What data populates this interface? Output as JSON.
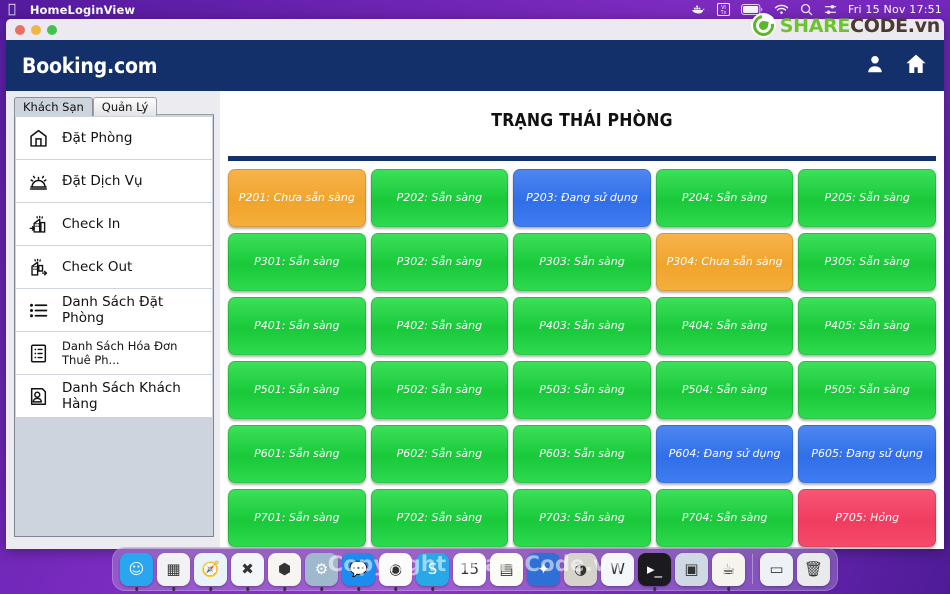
{
  "menubar": {
    "apple_glyph": "",
    "app_title": "HomeLoginView",
    "clock": "Fri 15 Nov  17:51",
    "icons": [
      "docker-whale-icon",
      "vitx-icon",
      "battery-icon",
      "wifi-icon",
      "search-icon",
      "control-center-icon"
    ]
  },
  "watermark": {
    "logo_share": "SHARE",
    "logo_code": "CODE.vn",
    "copyright": "Copyright ShareCode.vn",
    "brand_green": "#6cc32f",
    "brand_dark": "#4a3b2e"
  },
  "window": {
    "traffic_lights": [
      "close",
      "minimize",
      "zoom"
    ]
  },
  "header": {
    "brand": "Booking.com",
    "bg": "#13306b",
    "icons": [
      {
        "name": "user-account-icon"
      },
      {
        "name": "home-icon"
      }
    ]
  },
  "sidebar": {
    "tabs": [
      {
        "label": "Khách Sạn",
        "active": true
      },
      {
        "label": "Quản Lý",
        "active": false
      }
    ],
    "items": [
      {
        "label": "Đặt Phòng",
        "icon": "hotel-booking-icon",
        "small": false
      },
      {
        "label": "Đặt Dịch Vụ",
        "icon": "service-bell-icon",
        "small": false
      },
      {
        "label": "Check In",
        "icon": "hotel-check-in-icon",
        "small": false
      },
      {
        "label": "Check Out",
        "icon": "hotel-check-out-icon",
        "small": false
      },
      {
        "label": "Danh Sách Đặt Phòng",
        "icon": "list-icon",
        "small": false
      },
      {
        "label": "Danh Sách Hóa Đơn Thuê Ph...",
        "icon": "invoice-icon",
        "small": true
      },
      {
        "label": "Danh Sách Khách Hàng",
        "icon": "customer-card-icon",
        "small": false
      }
    ]
  },
  "main": {
    "title": "TRẠNG THÁI PHÒNG",
    "status_colors": {
      "green": "#2ed94e",
      "orange": "#f5ae3c",
      "blue": "#3e7cf0",
      "red": "#f44a6a"
    },
    "rooms": [
      {
        "label": "P201: Chưa sẵn sàng",
        "color": "orange"
      },
      {
        "label": "P202: Sẵn sàng",
        "color": "green"
      },
      {
        "label": "P203: Đang sử dụng",
        "color": "blue"
      },
      {
        "label": "P204: Sẵn sàng",
        "color": "green"
      },
      {
        "label": "P205: Sẵn sàng",
        "color": "green"
      },
      {
        "label": "P301: Sẵn sàng",
        "color": "green"
      },
      {
        "label": "P302: Sẵn sàng",
        "color": "green"
      },
      {
        "label": "P303: Sẵn sàng",
        "color": "green"
      },
      {
        "label": "P304: Chưa sẵn sàng",
        "color": "orange"
      },
      {
        "label": "P305: Sẵn sàng",
        "color": "green"
      },
      {
        "label": "P401: Sẵn sàng",
        "color": "green"
      },
      {
        "label": "P402: Sẵn sàng",
        "color": "green"
      },
      {
        "label": "P403: Sẵn sàng",
        "color": "green"
      },
      {
        "label": "P404: Sẵn sàng",
        "color": "green"
      },
      {
        "label": "P405: Sẵn sàng",
        "color": "green"
      },
      {
        "label": "P501: Sẵn sàng",
        "color": "green"
      },
      {
        "label": "P502: Sẵn sàng",
        "color": "green"
      },
      {
        "label": "P503: Sẵn sàng",
        "color": "green"
      },
      {
        "label": "P504: Sẵn sàng",
        "color": "green"
      },
      {
        "label": "P505: Sẵn sàng",
        "color": "green"
      },
      {
        "label": "P601: Sẵn sàng",
        "color": "green"
      },
      {
        "label": "P602: Sẵn sàng",
        "color": "green"
      },
      {
        "label": "P603: Sẵn sàng",
        "color": "green"
      },
      {
        "label": "P604: Đang sử dụng",
        "color": "blue"
      },
      {
        "label": "P605: Đang sử dụng",
        "color": "blue"
      },
      {
        "label": "P701: Sẵn sàng",
        "color": "green"
      },
      {
        "label": "P702: Sẵn sàng",
        "color": "green"
      },
      {
        "label": "P703: Sẵn sàng",
        "color": "green"
      },
      {
        "label": "P704: Sẵn sàng",
        "color": "green"
      },
      {
        "label": "P705: Hỏng",
        "color": "red"
      }
    ]
  },
  "dock": {
    "apps": [
      {
        "name": "finder-icon",
        "bg": "#2aa6f0",
        "glyph": "☺"
      },
      {
        "name": "launchpad-icon",
        "bg": "#f2f2f4",
        "glyph": "▦"
      },
      {
        "name": "safari-icon",
        "bg": "#e8f3fc",
        "glyph": "🧭"
      },
      {
        "name": "vscode-icon",
        "bg": "#f4f7fa",
        "glyph": "✖"
      },
      {
        "name": "unity-box-icon",
        "bg": "#f7f5f2",
        "glyph": "⬢"
      },
      {
        "name": "system-settings-icon",
        "bg": "#9fb8cc",
        "glyph": "⚙"
      },
      {
        "name": "zalo-icon",
        "bg": "#1b8df0",
        "glyph": "💬"
      },
      {
        "name": "chrome-icon",
        "bg": "#fafafa",
        "glyph": "◉"
      },
      {
        "name": "skype-icon",
        "bg": "#29a8e8",
        "glyph": "S"
      },
      {
        "name": "calendar-icon",
        "bg": "#ffffff",
        "glyph": "15"
      },
      {
        "name": "notes-icon",
        "bg": "#fbfbf5",
        "glyph": "▤"
      },
      {
        "name": "keynote-icon",
        "bg": "#2f6fd6",
        "glyph": "✦"
      },
      {
        "name": "photo-booth-icon",
        "bg": "#d6d3cc",
        "glyph": "◑"
      },
      {
        "name": "word-icon",
        "bg": "#f3f7fb",
        "glyph": "W"
      },
      {
        "name": "terminal-icon",
        "bg": "#1b1b1f",
        "glyph": "▸_"
      },
      {
        "name": "screenshot-icon",
        "bg": "#cfd9e4",
        "glyph": "▣"
      },
      {
        "name": "java-icon",
        "bg": "#f6f4ee",
        "glyph": "☕"
      }
    ],
    "right": [
      {
        "name": "window-preview-icon",
        "bg": "#eef2f7",
        "glyph": "▭"
      },
      {
        "name": "trash-icon",
        "bg": "#e8eaec",
        "glyph": "🗑"
      }
    ]
  }
}
